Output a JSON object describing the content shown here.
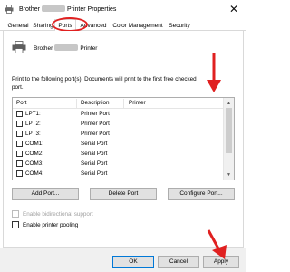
{
  "window": {
    "title_prefix": "Brother",
    "title_suffix": "Printer Properties",
    "close_glyph": "✕"
  },
  "tabs": [
    {
      "label": "General"
    },
    {
      "label": "Sharing"
    },
    {
      "label": "Ports"
    },
    {
      "label": "Advanced"
    },
    {
      "label": "Color Management"
    },
    {
      "label": "Security"
    }
  ],
  "printer": {
    "name_prefix": "Brother",
    "name_suffix": "Printer"
  },
  "instructions": "Print to the following port(s). Documents will print to the first free checked port.",
  "port_list": {
    "headers": {
      "port": "Port",
      "description": "Description",
      "printer": "Printer"
    },
    "rows": [
      {
        "port": "LPT1:",
        "description": "Printer Port",
        "checked": false
      },
      {
        "port": "LPT2:",
        "description": "Printer Port",
        "checked": false
      },
      {
        "port": "LPT3:",
        "description": "Printer Port",
        "checked": false
      },
      {
        "port": "COM1:",
        "description": "Serial Port",
        "checked": false
      },
      {
        "port": "COM2:",
        "description": "Serial Port",
        "checked": false
      },
      {
        "port": "COM3:",
        "description": "Serial Port",
        "checked": false
      },
      {
        "port": "COM4:",
        "description": "Serial Port",
        "checked": false
      }
    ]
  },
  "buttons": {
    "add_port": "Add Port...",
    "delete_port": "Delete Port",
    "configure_port": "Configure Port...",
    "ok": "OK",
    "cancel": "Cancel",
    "apply": "Apply"
  },
  "options": {
    "bidirectional": {
      "label": "Enable bidirectional support",
      "checked": false,
      "enabled": false
    },
    "pooling": {
      "label": "Enable printer pooling",
      "checked": false,
      "enabled": true
    }
  },
  "colors": {
    "annotation_red": "#e02020",
    "tab_border": "#d9d9d9",
    "button_face": "#e1e1e1"
  }
}
